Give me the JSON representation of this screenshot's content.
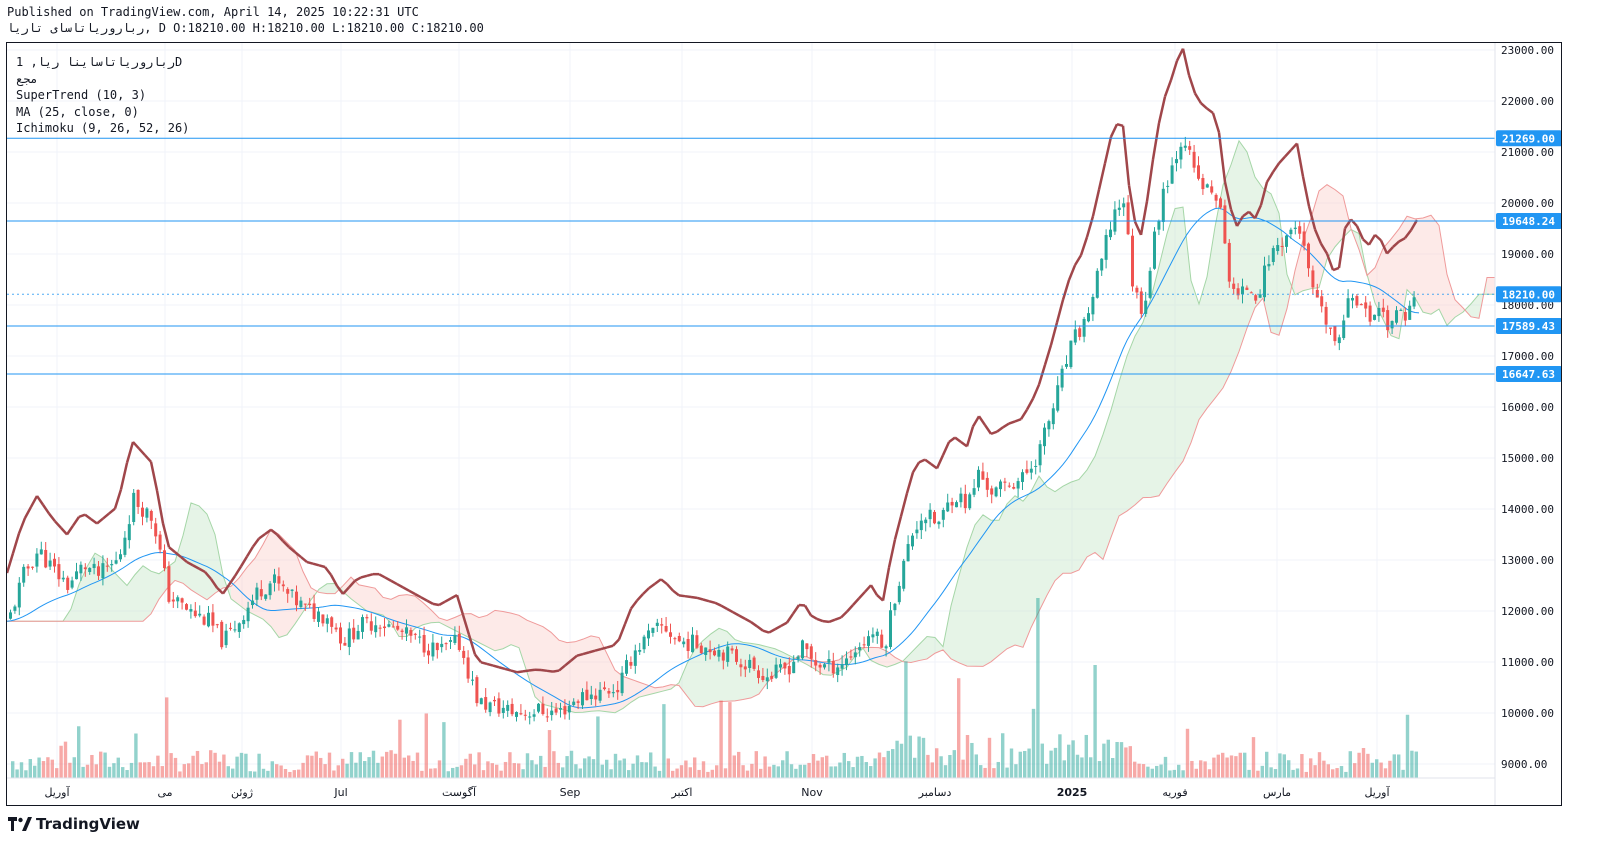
{
  "header": {
    "published": "Published on TradingView.com, April 14, 2025 10:22:31 UTC",
    "symbol_line": "رباروریاتاسای تاریا, D O:18210.00 H:18210.00 L:18210.00 C:18210.00"
  },
  "legend": {
    "symbol": "رباروریاتاساینا ریا, 1D",
    "exchange": "مجع",
    "supertrend": "SuperTrend (10, 3)",
    "ma": "MA (25, close, 0)",
    "ichimoku": "Ichimoku (9, 26, 52, 26)"
  },
  "branding": {
    "logo_text": "TradingView"
  },
  "colors": {
    "up": "#26a69a",
    "down": "#ef5350",
    "supertrend_up": "#4caf50",
    "supertrend_down": "#a0464a",
    "ma": "#2196f3",
    "level": "#2196f3",
    "cloud_green": "#c8e6c9",
    "cloud_red": "#fbd0cc"
  },
  "chart_data": {
    "type": "candlestick",
    "y_axis": {
      "range": [
        8750,
        23100
      ],
      "ticks": [
        "23000.00",
        "22000.00",
        "21000.00",
        "20000.00",
        "19000.00",
        "18000.00",
        "17000.00",
        "16000.00",
        "15000.00",
        "14000.00",
        "13000.00",
        "12000.00",
        "11000.00",
        "10000.00",
        "9000.00"
      ]
    },
    "x_axis": {
      "ticks": [
        "آوریل",
        "می",
        "ژوئن",
        "Jul",
        "آگوست",
        "Sep",
        "اکتبر",
        "Nov",
        "دسامبر",
        "2025",
        "فوریه",
        "مارس",
        "آوریل"
      ]
    },
    "price_levels": [
      {
        "label": "21269.00",
        "value": 21269
      },
      {
        "label": "19648.24",
        "value": 19648.24
      },
      {
        "label": "18210.00",
        "value": 18210,
        "current": true
      },
      {
        "label": "17589.43",
        "value": 17589.43
      },
      {
        "label": "16647.63",
        "value": 16647.63
      }
    ],
    "close_path": [
      [
        0,
        11800
      ],
      [
        15,
        12700
      ],
      [
        30,
        13200
      ],
      [
        45,
        12800
      ],
      [
        60,
        12500
      ],
      [
        75,
        12900
      ],
      [
        90,
        12700
      ],
      [
        110,
        13000
      ],
      [
        125,
        14200
      ],
      [
        145,
        13800
      ],
      [
        160,
        12300
      ],
      [
        180,
        12000
      ],
      [
        200,
        11800
      ],
      [
        215,
        11400
      ],
      [
        230,
        11800
      ],
      [
        250,
        12400
      ],
      [
        265,
        12600
      ],
      [
        280,
        12300
      ],
      [
        300,
        12000
      ],
      [
        320,
        11900
      ],
      [
        335,
        11400
      ],
      [
        350,
        11700
      ],
      [
        370,
        11800
      ],
      [
        390,
        11600
      ],
      [
        410,
        11400
      ],
      [
        430,
        11200
      ],
      [
        450,
        11400
      ],
      [
        470,
        10200
      ],
      [
        490,
        10100
      ],
      [
        510,
        10000
      ],
      [
        530,
        10050
      ],
      [
        550,
        10000
      ],
      [
        570,
        10300
      ],
      [
        590,
        10400
      ],
      [
        610,
        10500
      ],
      [
        625,
        11200
      ],
      [
        640,
        11500
      ],
      [
        655,
        11700
      ],
      [
        670,
        11400
      ],
      [
        690,
        11350
      ],
      [
        710,
        11250
      ],
      [
        730,
        11050
      ],
      [
        745,
        10900
      ],
      [
        760,
        10700
      ],
      [
        780,
        10900
      ],
      [
        795,
        11300
      ],
      [
        805,
        11000
      ],
      [
        820,
        10900
      ],
      [
        835,
        11000
      ],
      [
        850,
        11300
      ],
      [
        865,
        11600
      ],
      [
        875,
        11200
      ],
      [
        885,
        12200
      ],
      [
        895,
        12900
      ],
      [
        905,
        13600
      ],
      [
        915,
        13900
      ],
      [
        930,
        13700
      ],
      [
        945,
        14300
      ],
      [
        960,
        14100
      ],
      [
        970,
        14700
      ],
      [
        985,
        14300
      ],
      [
        1000,
        14500
      ],
      [
        1015,
        14600
      ],
      [
        1030,
        15100
      ],
      [
        1045,
        16000
      ],
      [
        1055,
        16700
      ],
      [
        1065,
        17300
      ],
      [
        1075,
        17600
      ],
      [
        1085,
        18200
      ],
      [
        1095,
        19000
      ],
      [
        1105,
        19800
      ],
      [
        1115,
        20100
      ],
      [
        1125,
        18300
      ],
      [
        1135,
        17900
      ],
      [
        1145,
        19200
      ],
      [
        1155,
        20300
      ],
      [
        1165,
        20800
      ],
      [
        1175,
        21400
      ],
      [
        1185,
        20600
      ],
      [
        1195,
        20300
      ],
      [
        1210,
        20100
      ],
      [
        1220,
        18600
      ],
      [
        1230,
        18100
      ],
      [
        1240,
        18400
      ],
      [
        1250,
        18200
      ],
      [
        1260,
        18900
      ],
      [
        1270,
        19200
      ],
      [
        1280,
        19400
      ],
      [
        1290,
        19600
      ],
      [
        1300,
        18600
      ],
      [
        1310,
        17900
      ],
      [
        1320,
        17600
      ],
      [
        1330,
        17100
      ],
      [
        1340,
        18300
      ],
      [
        1350,
        18100
      ],
      [
        1360,
        17700
      ],
      [
        1370,
        18000
      ],
      [
        1380,
        17600
      ],
      [
        1390,
        17800
      ],
      [
        1400,
        17900
      ],
      [
        1410,
        18210
      ]
    ]
  }
}
